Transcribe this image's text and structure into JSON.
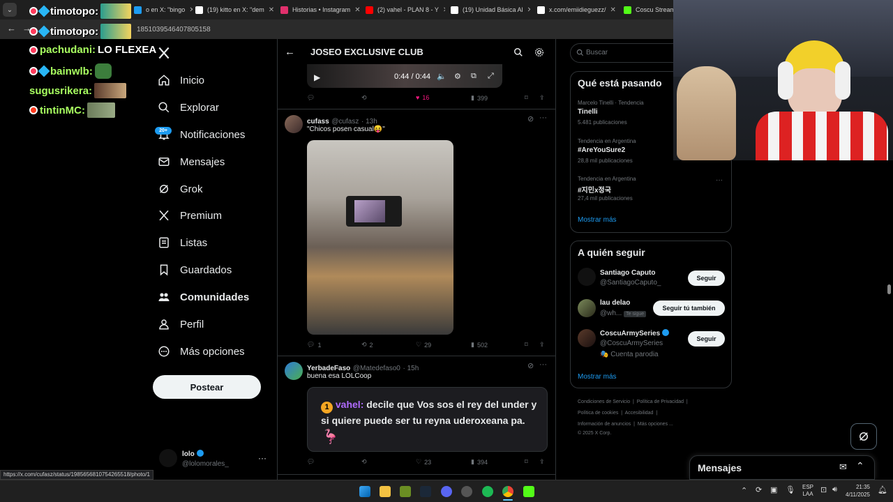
{
  "browser": {
    "tabs": [
      {
        "label": "o en X: \"bingo",
        "color": "#1d9bf0"
      },
      {
        "label": "(19) kitto en X: \"dem",
        "color": "#ffffff"
      },
      {
        "label": "Historias • Instagram",
        "color": "#e1306c"
      },
      {
        "label": "(2) vahel - PLAN 8 - Y",
        "color": "#ff0000"
      },
      {
        "label": "(19) Unidad Básica Al",
        "color": "#ffffff"
      },
      {
        "label": "x.com/emiidieguezz/",
        "color": "#ffffff"
      },
      {
        "label": "Coscu Stream -",
        "color": "#53fc18"
      }
    ],
    "url": "1851039546407805158",
    "status_url": "https://x.com/cufasz/status/1985656810754265518/photo/1"
  },
  "overlay": {
    "chat": [
      {
        "user": "timotopo:",
        "color": "#ffffff",
        "badge": "#ff3b5c"
      },
      {
        "user": "timotopo:",
        "color": "#ffffff",
        "badge": "#ff3b5c"
      },
      {
        "user": "pachudani:",
        "text": "LO FLEXEA",
        "color": "#a8ff60",
        "badge": "#ff3b5c"
      },
      {
        "user": "bainwlb:",
        "color": "#a8ff60",
        "badge": "#ff3b5c"
      },
      {
        "user": "sugusrikera:",
        "color": "#a8ff60",
        "badge": ""
      },
      {
        "user": "tintinMC:",
        "color": "#a8ff60",
        "badge": "#ff3b1f"
      }
    ]
  },
  "nav": {
    "items": [
      {
        "label": "Inicio",
        "icon": "home-icon"
      },
      {
        "label": "Explorar",
        "icon": "search-icon"
      },
      {
        "label": "Notificaciones",
        "icon": "bell-icon"
      },
      {
        "label": "Mensajes",
        "icon": "mail-icon"
      },
      {
        "label": "Grok",
        "icon": "grok-icon"
      },
      {
        "label": "Premium",
        "icon": "x-logo-icon"
      },
      {
        "label": "Listas",
        "icon": "list-icon"
      },
      {
        "label": "Guardados",
        "icon": "bookmark-icon"
      },
      {
        "label": "Comunidades",
        "icon": "community-icon"
      },
      {
        "label": "Perfil",
        "icon": "person-icon"
      },
      {
        "label": "Más opciones",
        "icon": "more-circle-icon"
      }
    ],
    "notif_badge": "20+",
    "post_label": "Postear",
    "account": {
      "name": "lolo",
      "handle": "@lolomorales_"
    }
  },
  "header": {
    "title": "JOSEO EXCLUSIVE CLUB"
  },
  "video": {
    "time": "0:44 / 0:44"
  },
  "tweets": [
    {
      "likes": "16",
      "views": "399"
    },
    {
      "name": "cufass",
      "handle": "@cufasz",
      "time": "· 13h",
      "text": "\"Chicos posen casual😝\"",
      "replies": "1",
      "retweets": "2",
      "likes": "29",
      "views": "502"
    },
    {
      "name": "YerbadeFaso",
      "handle": "@Matedefaso0",
      "time": "· 15h",
      "text": "buena esa LOLCoop",
      "embed_user": "vahel:",
      "embed_text": "decile que Vos sos el rey del under y si quiere puede ser tu reyna uderoxeana pa.",
      "likes": "23",
      "views": "394"
    }
  ],
  "sidebar": {
    "search_placeholder": "Buscar",
    "trends_title": "Qué está pasando",
    "trends": [
      {
        "meta": "Marcelo Tinelli · Tendencia",
        "name": "Tinelli",
        "count": "5.481 publicaciones"
      },
      {
        "meta": "Tendencia en Argentina",
        "name": "#AreYouSure2",
        "count": "28,8 mil publicaciones"
      },
      {
        "meta": "Tendencia en Argentina",
        "name": "#지민x정국",
        "count": "27,4 mil publicaciones"
      }
    ],
    "show_more": "Mostrar más",
    "follow_title": "A quién seguir",
    "follow": [
      {
        "name": "Santiago Caputo",
        "handle": "@SantiagoCaputo_",
        "button": "Seguir"
      },
      {
        "name": "lau delao",
        "handle": "@wh...",
        "extra": "Te sigue",
        "button": "Seguir tú también"
      },
      {
        "name": "CoscuArmySeries",
        "handle": "@CoscuArmySeries",
        "extra": "🎭 Cuenta parodia",
        "button": "Seguir"
      }
    ],
    "show_more2": "Mostrar más",
    "footer": [
      "Condiciones de Servicio",
      "Política de Privacidad",
      "Política de cookies",
      "Accesibilidad",
      "Información de anuncios",
      "Más opciones ...",
      "© 2025 X Corp."
    ]
  },
  "messages": {
    "title": "Mensajes"
  },
  "taskbar": {
    "lang1": "ESP",
    "lang2": "LAA",
    "time": "21:35",
    "date": "4/11/2025"
  }
}
